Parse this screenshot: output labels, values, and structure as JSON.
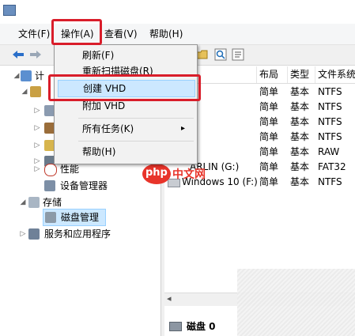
{
  "menubar": {
    "file": "文件(F)",
    "action": "操作(A)",
    "view": "查看(V)",
    "help": "帮助(H)"
  },
  "context_menu": {
    "items": [
      {
        "label": "刷新(F)"
      },
      {
        "label": "重新扫描磁盘(R)"
      },
      {
        "label": "创建 VHD"
      },
      {
        "label": "附加 VHD"
      },
      {
        "label": "所有任务(K)"
      },
      {
        "label": "帮助(H)"
      }
    ],
    "submenu_arrow": "▸"
  },
  "tree": {
    "computer": "计",
    "performance": "性能",
    "device_manager": "设备管理器",
    "storage": "存储",
    "disk_management": "磁盘管理",
    "services": "服务和应用程序",
    "expand_open": "◢",
    "expand_closed": "▷"
  },
  "grid": {
    "headers": {
      "layout": "布局",
      "type": "类型",
      "fs": "文件系统"
    },
    "rows": [
      {
        "name": "",
        "layout": "简单",
        "type": "基本",
        "fs": "NTFS"
      },
      {
        "name": "",
        "layout": "简单",
        "type": "基本",
        "fs": "NTFS"
      },
      {
        "name": "",
        "layout": "简单",
        "type": "基本",
        "fs": "NTFS"
      },
      {
        "name": "",
        "layout": "简单",
        "type": "基本",
        "fs": "NTFS"
      },
      {
        "name": "",
        "layout": "简单",
        "type": "基本",
        "fs": "RAW"
      },
      {
        "name": "ARLIN (G:)",
        "layout": "简单",
        "type": "基本",
        "fs": "FAT32"
      },
      {
        "name": "Windows 10 (F:)",
        "layout": "简单",
        "type": "基本",
        "fs": "NTFS"
      }
    ],
    "disk_label": "磁盘 0",
    "scroll_left": "◂"
  },
  "watermark": {
    "brand": "php",
    "cn": "中文网"
  },
  "colors": {
    "highlight_red": "#d91d2a",
    "menu_hover": "#cce8ff",
    "watermark_red": "#e8342a"
  }
}
